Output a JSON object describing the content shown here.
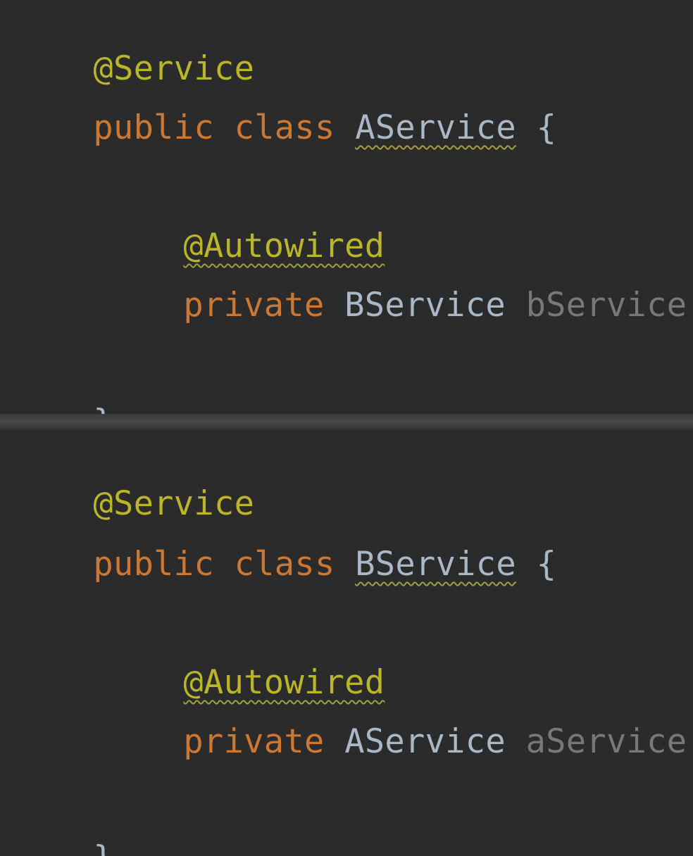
{
  "panels": [
    {
      "lines": {
        "class_annotation": "@Service",
        "class_decl_public": "public",
        "class_decl_class": "class",
        "class_name": "AService",
        "open_brace": "{",
        "field_annotation": "@Autowired",
        "field_modifier": "private",
        "field_type": "BService",
        "field_name": "bService",
        "field_semicolon": ";",
        "close_brace": "}"
      }
    },
    {
      "lines": {
        "class_annotation": "@Service",
        "class_decl_public": "public",
        "class_decl_class": "class",
        "class_name": "BService",
        "open_brace": "{",
        "field_annotation": "@Autowired",
        "field_modifier": "private",
        "field_type": "AService",
        "field_name": "aService",
        "field_semicolon": ";",
        "close_brace": "}"
      }
    }
  ],
  "colors": {
    "background": "#2b2b2b",
    "annotation": "#bbb529",
    "keyword": "#cc7832",
    "type": "#a9b7c6",
    "field": "#787878"
  }
}
